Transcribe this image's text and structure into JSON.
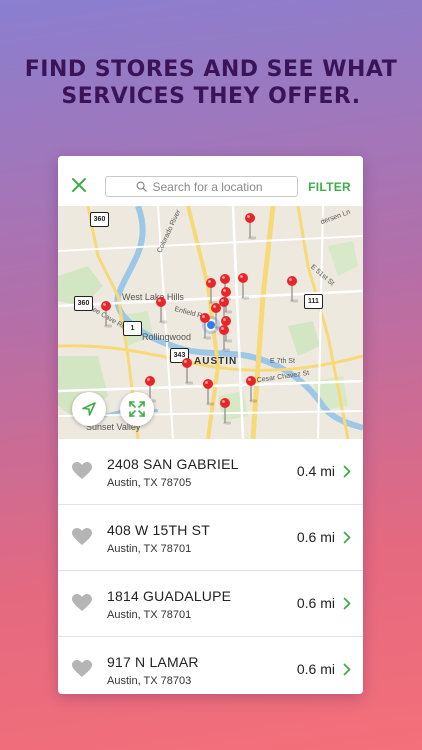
{
  "headline": {
    "line1": "FIND STORES AND SEE WHAT",
    "line2": "SERVICES THEY OFFER."
  },
  "topbar": {
    "close_icon": "close-x-icon",
    "search_placeholder": "Search for a location",
    "filter_label": "FILTER"
  },
  "map": {
    "labels": {
      "west_lake_hills": "West Lake Hills",
      "rollingwood": "Rollingwood",
      "austin": "AUSTIN",
      "sunset_valley": "Sunset Valley",
      "bee_caves_rd": "Bee Cave Rd",
      "e_51st": "E 51st St",
      "e_cesar_chavez": "E Cesar Chavez St",
      "enfield": "Enfield Rd",
      "e_7th": "E 7th St",
      "andersen_ln": "dersen Ln",
      "colorado_river": "Colorado River"
    },
    "shields": {
      "s360a": "360",
      "s360b": "360",
      "s111": "111",
      "s343": "343",
      "s1": "1"
    },
    "locate_icon": "navigation-arrow-icon",
    "expand_icon": "expand-arrows-icon"
  },
  "stores": [
    {
      "street": "2408 SAN GABRIEL",
      "city": "Austin, TX 78705",
      "distance": "0.4 mi"
    },
    {
      "street": "408 W 15TH ST",
      "city": "Austin, TX 78701",
      "distance": "0.6 mi"
    },
    {
      "street": "1814 GUADALUPE",
      "city": "Austin, TX 78701",
      "distance": "0.6 mi"
    },
    {
      "street": "917 N LAMAR",
      "city": "Austin, TX 78703",
      "distance": "0.6 mi"
    }
  ],
  "colors": {
    "accent_green": "#3fae49",
    "headline": "#3a1457",
    "pin_red": "#e8262a",
    "heart_grey": "#b5b5b5"
  }
}
